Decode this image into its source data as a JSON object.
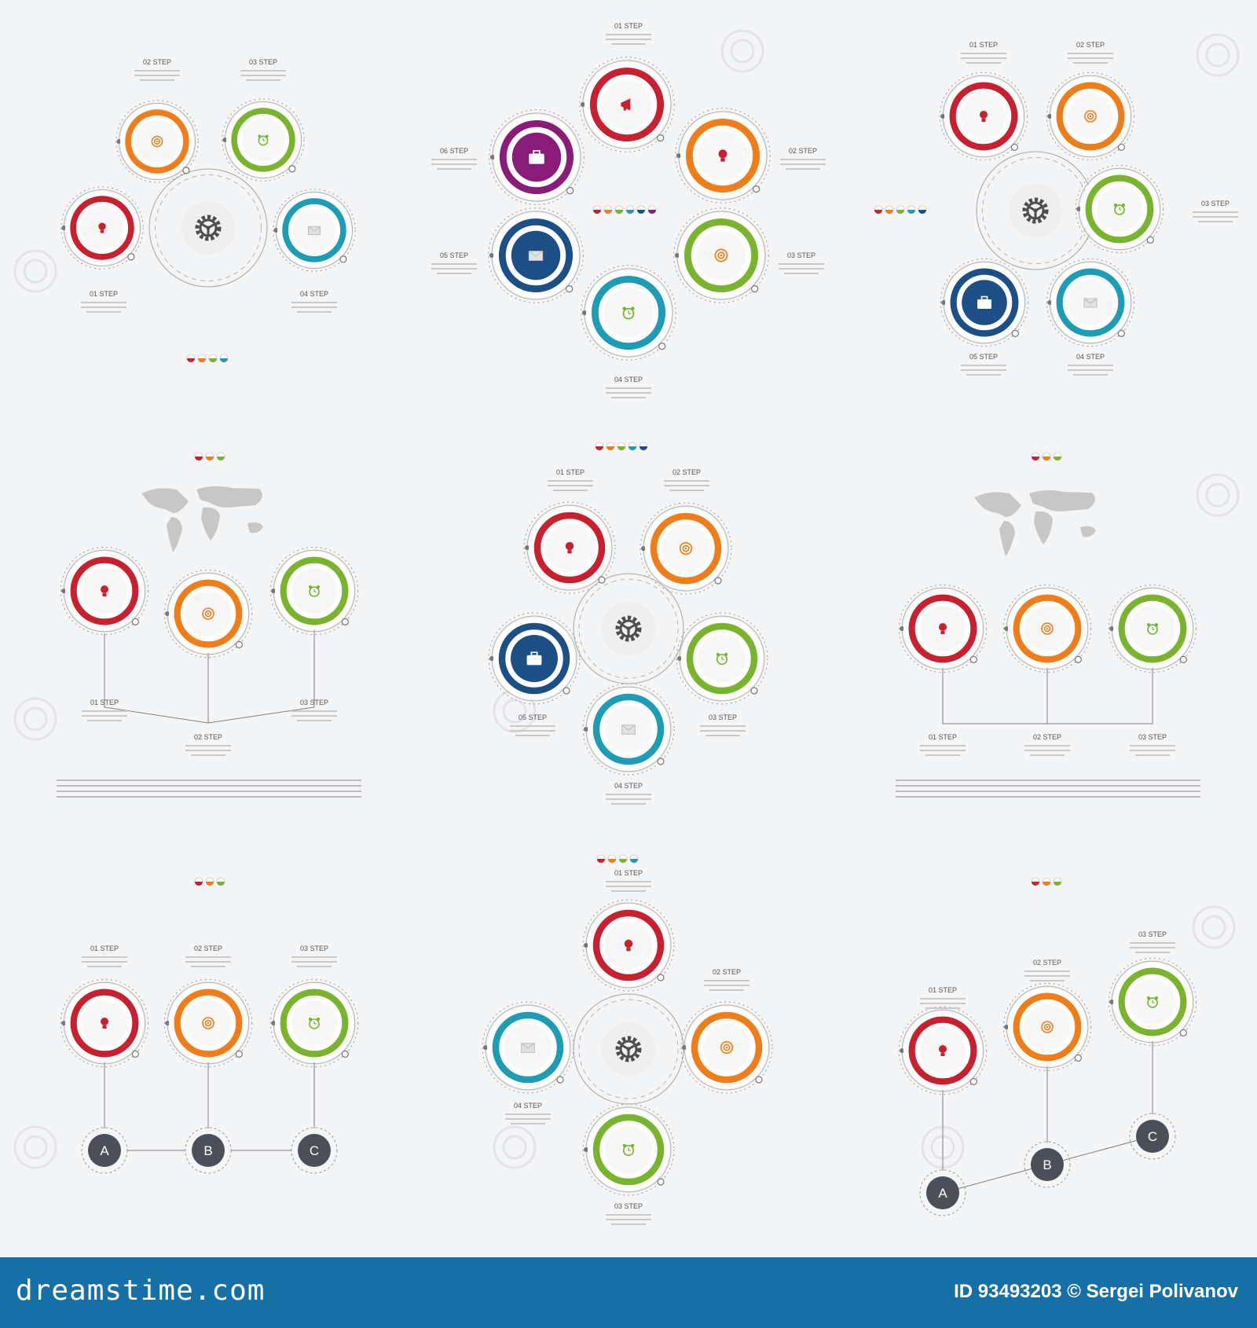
{
  "colors": {
    "red": "#c8202e",
    "orange": "#ef7d1a",
    "green": "#7ab42f",
    "teal": "#1d9cb5",
    "navy": "#1b4f86",
    "purple": "#8a1c78",
    "line": "#808080",
    "background": "#f4f5f7",
    "footer": "#1670a6"
  },
  "step_labels": {
    "s01": "01 STEP",
    "s02": "02 STEP",
    "s03": "03 STEP",
    "s04": "04 STEP",
    "s05": "05 STEP",
    "s06": "06 STEP"
  },
  "node_letters": [
    "A",
    "B",
    "C"
  ],
  "icons": {
    "bulb": "lightbulb-icon",
    "target": "target-icon",
    "alarm": "alarm-clock-icon",
    "mail": "envelope-icon",
    "case": "briefcase-icon",
    "megaphone": "megaphone-icon",
    "gear": "gear-icon"
  },
  "footer": {
    "brand": "dreamstime.com",
    "credit": "ID 93493203 © Sergei Polivanov"
  }
}
